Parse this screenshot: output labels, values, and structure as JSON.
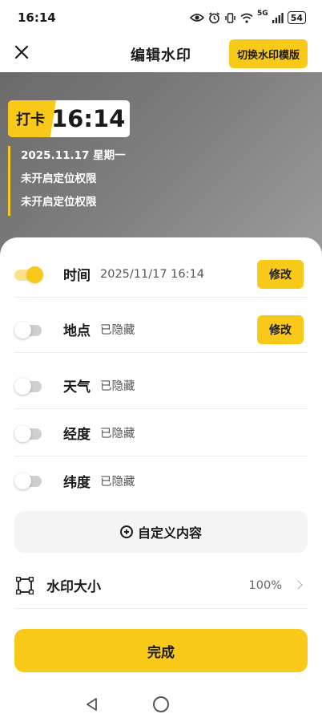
{
  "status_bar": {
    "time": "16:14",
    "network": "5G",
    "battery": "54",
    "icons": [
      "eye-icon",
      "alarm-icon",
      "vibrate-icon",
      "wifi-icon",
      "signal-icon",
      "battery-icon"
    ]
  },
  "header": {
    "title": "编辑水印",
    "switch_template_label": "切换水印模版",
    "close_icon": "close-icon"
  },
  "watermark": {
    "label": "打卡",
    "time": "16:14",
    "lines": [
      "2025.11.17 星期一",
      "未开启定位权限",
      "未开启定位权限"
    ]
  },
  "settings": {
    "rows": [
      {
        "label": "时间",
        "value": "2025/11/17 16:14",
        "enabled": true,
        "edit_label": "修改"
      },
      {
        "label": "地点",
        "value": "已隐藏",
        "enabled": false,
        "edit_label": "修改"
      },
      {
        "label": "天气",
        "value": "已隐藏",
        "enabled": false
      },
      {
        "label": "经度",
        "value": "已隐藏",
        "enabled": false
      },
      {
        "label": "纬度",
        "value": "已隐藏",
        "enabled": false
      }
    ],
    "custom_button_label": "自定义内容",
    "size_label": "水印大小",
    "size_value": "100%",
    "done_label": "完成"
  },
  "colors": {
    "accent": "#f9c91a",
    "preview_background": "#7d7d7d",
    "toggle_off": "#cfcfcf"
  }
}
